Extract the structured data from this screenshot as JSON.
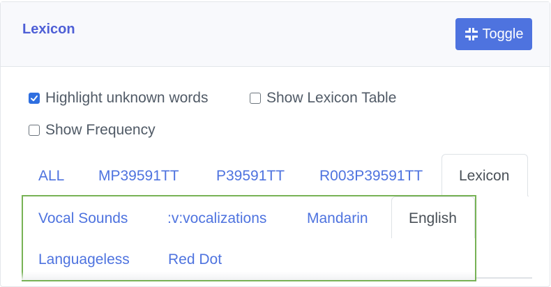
{
  "card": {
    "title": "Lexicon",
    "toggle_label": "Toggle"
  },
  "options": {
    "highlight_unknown": {
      "label": "Highlight unknown words",
      "checked": true
    },
    "show_lexicon_table": {
      "label": "Show Lexicon Table",
      "checked": false
    },
    "show_frequency": {
      "label": "Show Frequency",
      "checked": false
    }
  },
  "tabs": [
    {
      "label": "ALL"
    },
    {
      "label": "MP39591TT"
    },
    {
      "label": "P39591TT"
    },
    {
      "label": "R003P39591TT"
    },
    {
      "label": "Lexicon",
      "active": true
    }
  ],
  "subtabs": [
    {
      "label": "Vocal Sounds"
    },
    {
      "label": ":v:vocalizations"
    },
    {
      "label": "Mandarin"
    },
    {
      "label": "English",
      "active": true
    },
    {
      "label": "Languageless"
    },
    {
      "label": "Red Dot"
    }
  ],
  "colors": {
    "accent": "#4e73df",
    "title": "#4e5fd6",
    "highlight_border": "#77b255",
    "checkbox_checked": "#2f6fe0"
  },
  "icons": {
    "toggle": "compress-icon",
    "checkbox": "check-icon"
  }
}
